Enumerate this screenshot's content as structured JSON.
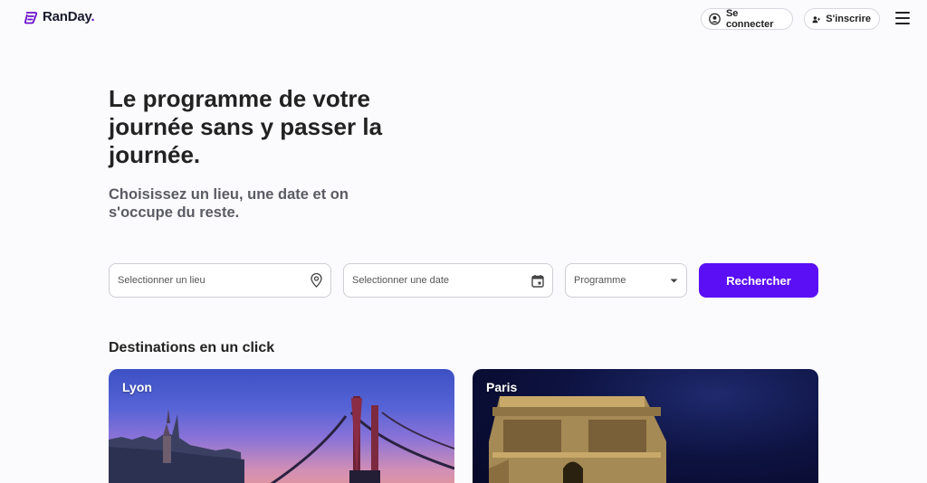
{
  "brand": {
    "name": "RanDay",
    "dot": ".",
    "accent_color": "#5a0ff5"
  },
  "header": {
    "login_label": "Se connecter",
    "signup_label": "S'inscrire",
    "menu_icon": "hamburger-menu-icon"
  },
  "hero": {
    "title": "Le programme de votre journée sans y passer la journée.",
    "subtitle": "Choisissez un lieu, une date et on s'occupe du reste."
  },
  "search": {
    "location_placeholder": "Selectionner un lieu",
    "location_icon": "map-pin-icon",
    "date_placeholder": "Selectionner une date",
    "date_icon": "calendar-icon",
    "program_value": "Programme",
    "program_icon": "chevron-down-icon",
    "button_label": "Rechercher"
  },
  "destinations": {
    "title": "Destinations en un click",
    "cards": [
      {
        "label": "Lyon"
      },
      {
        "label": "Paris"
      }
    ]
  }
}
